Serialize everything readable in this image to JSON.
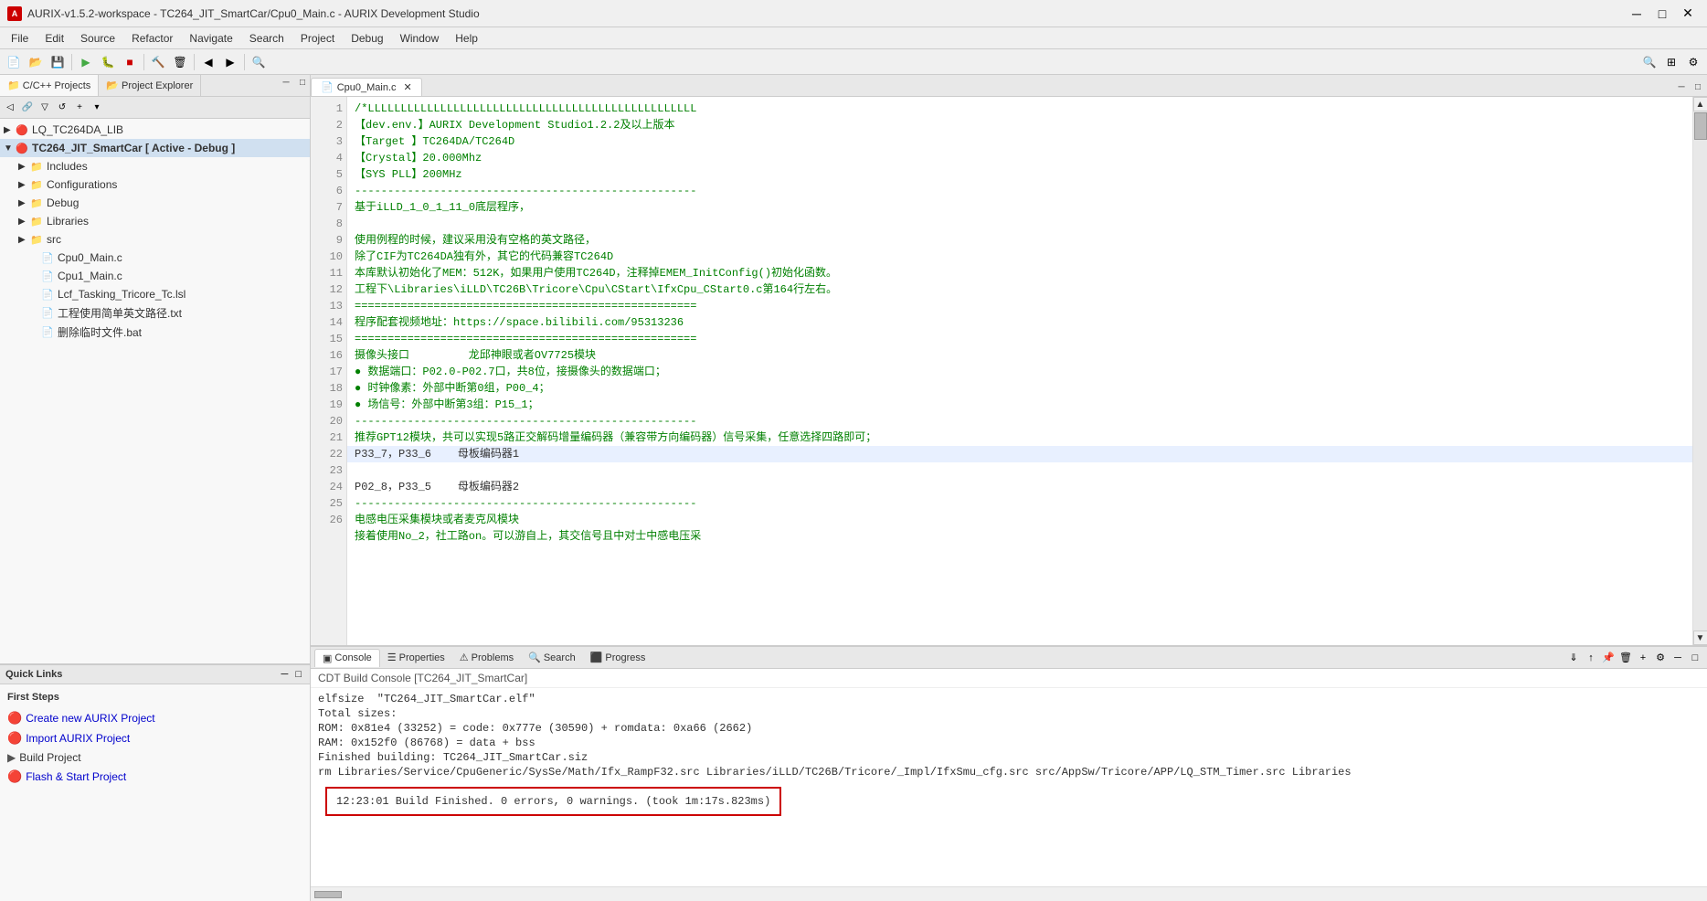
{
  "titleBar": {
    "title": "AURIX-v1.5.2-workspace - TC264_JIT_SmartCar/Cpu0_Main.c - AURIX Development Studio",
    "appIcon": "A"
  },
  "menuBar": {
    "items": [
      "File",
      "Edit",
      "Source",
      "Refactor",
      "Navigate",
      "Search",
      "Project",
      "Debug",
      "Window",
      "Help"
    ]
  },
  "leftPanel": {
    "tabs": [
      {
        "label": "C/C++ Projects",
        "icon": "📁",
        "active": true
      },
      {
        "label": "Project Explorer",
        "icon": "📂",
        "active": false
      }
    ],
    "tree": [
      {
        "id": "lq_lib",
        "label": "LQ_TC264DA_LIB",
        "level": 0,
        "type": "project",
        "expanded": false,
        "arrow": "▶"
      },
      {
        "id": "tc264_project",
        "label": "TC264_JIT_SmartCar [ Active - Debug ]",
        "level": 0,
        "type": "project",
        "expanded": true,
        "arrow": "▼",
        "selected": true
      },
      {
        "id": "includes",
        "label": "Includes",
        "level": 1,
        "type": "folder",
        "expanded": false,
        "arrow": "▶"
      },
      {
        "id": "configurations",
        "label": "Configurations",
        "level": 1,
        "type": "folder",
        "expanded": false,
        "arrow": "▶"
      },
      {
        "id": "debug",
        "label": "Debug",
        "level": 1,
        "type": "folder",
        "expanded": false,
        "arrow": "▶"
      },
      {
        "id": "libraries",
        "label": "Libraries",
        "level": 1,
        "type": "folder",
        "expanded": false,
        "arrow": "▶"
      },
      {
        "id": "src",
        "label": "src",
        "level": 1,
        "type": "folder",
        "expanded": false,
        "arrow": "▶"
      },
      {
        "id": "cpu0main",
        "label": "Cpu0_Main.c",
        "level": 1,
        "type": "file",
        "arrow": ""
      },
      {
        "id": "cpu1main",
        "label": "Cpu1_Main.c",
        "level": 1,
        "type": "file",
        "arrow": ""
      },
      {
        "id": "lcf",
        "label": "Lcf_Tasking_Tricore_Tc.lsl",
        "level": 1,
        "type": "file",
        "arrow": ""
      },
      {
        "id": "path_txt",
        "label": "工程使用简单英文路径.txt",
        "level": 1,
        "type": "file",
        "arrow": ""
      },
      {
        "id": "bat",
        "label": "删除临时文件.bat",
        "level": 1,
        "type": "file",
        "arrow": ""
      }
    ]
  },
  "quickLinks": {
    "title": "Quick Links",
    "section": "First Steps",
    "links": [
      {
        "label": "Create new AURIX Project",
        "icon": "🔴",
        "type": "icon-link"
      },
      {
        "label": "Import AURIX Project",
        "icon": "🔴",
        "type": "icon-link"
      },
      {
        "label": "Build Project",
        "icon": "▶",
        "type": "arrow-link"
      },
      {
        "label": "Flash & Start Project",
        "icon": "🔴",
        "type": "icon-link"
      }
    ]
  },
  "editor": {
    "tabs": [
      {
        "label": "Cpu0_Main.c",
        "active": true,
        "icon": "📄"
      }
    ],
    "lines": [
      {
        "num": 1,
        "text": "/*LLLLLLLLLLLLLLLLLLLLLLLLLLLLLLLLLLLLLLLLLLLLLLLLLL",
        "type": "comment"
      },
      {
        "num": 2,
        "text": "【dev.env.】AURIX Development Studio1.2.2及以上版本",
        "type": "comment"
      },
      {
        "num": 3,
        "text": "【Target 】TC264DA/TC264D",
        "type": "comment"
      },
      {
        "num": 4,
        "text": "【Crystal】20.000Mhz",
        "type": "comment"
      },
      {
        "num": 5,
        "text": "【SYS PLL】200MHz",
        "type": "comment"
      },
      {
        "num": 6,
        "text": "----------------------------------------------------",
        "type": "comment"
      },
      {
        "num": 7,
        "text": "基于iLLD_1_0_1_11_0底层程序，",
        "type": "comment"
      },
      {
        "num": 8,
        "text": "",
        "type": "normal"
      },
      {
        "num": 9,
        "text": "使用例程的时候，建议采用没有空格的英文路径，",
        "type": "comment"
      },
      {
        "num": 10,
        "text": "除了CIF为TC264DA独有外，其它的代码兼容TC264D",
        "type": "comment"
      },
      {
        "num": 11,
        "text": "本库默认初始化了MEM：512K，如果用户使用TC264D，注释掉EMEM_InitConfig()初始化函数。",
        "type": "comment"
      },
      {
        "num": 12,
        "text": "工程下\\Libraries\\iLLD\\TC26B\\Tricore\\Cpu\\CStart\\IfxCpu_CStart0.c第164行左右。",
        "type": "comment"
      },
      {
        "num": 13,
        "text": "====================================================",
        "type": "comment"
      },
      {
        "num": 14,
        "text": "程序配套视频地址：https://space.bilibili.com/95313236",
        "type": "comment"
      },
      {
        "num": 15,
        "text": "====================================================",
        "type": "comment"
      },
      {
        "num": 16,
        "text": "摄像头接口         龙邱神眼或者OV7725模块",
        "type": "comment"
      },
      {
        "num": 17,
        "text": "● 数据端口：P02.0-P02.7口，共8位，接摄像头的数据端口；",
        "type": "comment"
      },
      {
        "num": 18,
        "text": "● 时钟像素：外部中断第0组，P00_4；",
        "type": "comment"
      },
      {
        "num": 19,
        "text": "● 场信号：外部中断第3组：P15_1；",
        "type": "comment"
      },
      {
        "num": 20,
        "text": "----------------------------------------------------",
        "type": "comment"
      },
      {
        "num": 21,
        "text": "推荐GPT12模块，共可以实现5路正交解码增量编码器（兼容带方向编码器）信号采集，任意选择四路即可；",
        "type": "comment"
      },
      {
        "num": 22,
        "text": "P33_7，P33_6    母板编码器1",
        "type": "normal",
        "highlight": true
      },
      {
        "num": 23,
        "text": "P02_8，P33_5    母板编码器2",
        "type": "normal"
      },
      {
        "num": 24,
        "text": "----------------------------------------------------",
        "type": "comment"
      },
      {
        "num": 25,
        "text": "电感电压采集模块或者麦克风模块",
        "type": "comment"
      },
      {
        "num": 26,
        "text": "接着使用No_2，社工路on。可以游自上，其交信号且中对士中感电压采",
        "type": "comment"
      }
    ]
  },
  "console": {
    "tabs": [
      {
        "label": "Console",
        "active": true,
        "icon": "▣"
      },
      {
        "label": "Properties",
        "active": false,
        "icon": "☰"
      },
      {
        "label": "Problems",
        "active": false,
        "icon": "⚠"
      },
      {
        "label": "Search",
        "active": false,
        "icon": "🔍"
      },
      {
        "label": "Progress",
        "active": false,
        "icon": "⬛"
      }
    ],
    "title": "CDT Build Console [TC264_JIT_SmartCar]",
    "outputLines": [
      "elfsize  \"TC264_JIT_SmartCar.elf\"",
      "Total sizes:",
      "ROM: 0x81e4 (33252) = code: 0x777e (30590) + romdata: 0xa66 (2662)",
      "RAM: 0x152f0 (86768) = data + bss",
      "Finished building: TC264_JIT_SmartCar.siz",
      "",
      "rm Libraries/Service/CpuGeneric/SysSe/Math/Ifx_RampF32.src Libraries/iLLD/TC26B/Tricore/_Impl/IfxSmu_cfg.src src/AppSw/Tricore/APP/LQ_STM_Timer.src Libraries"
    ],
    "buildResult": "12:23:01 Build Finished. 0 errors, 0 warnings. (took 1m:17s.823ms)"
  }
}
